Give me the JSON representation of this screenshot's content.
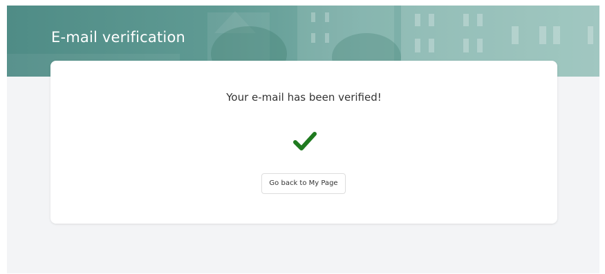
{
  "header": {
    "title": "E-mail verification"
  },
  "verification": {
    "message": "Your e-mail has been verified!",
    "status_icon": "checkmark-icon",
    "back_button_label": "Go back to My Page"
  },
  "colors": {
    "header_teal": "#5f9a93",
    "check_green": "#1f7a1f",
    "page_background": "#f3f4f6",
    "card_background": "#ffffff"
  }
}
